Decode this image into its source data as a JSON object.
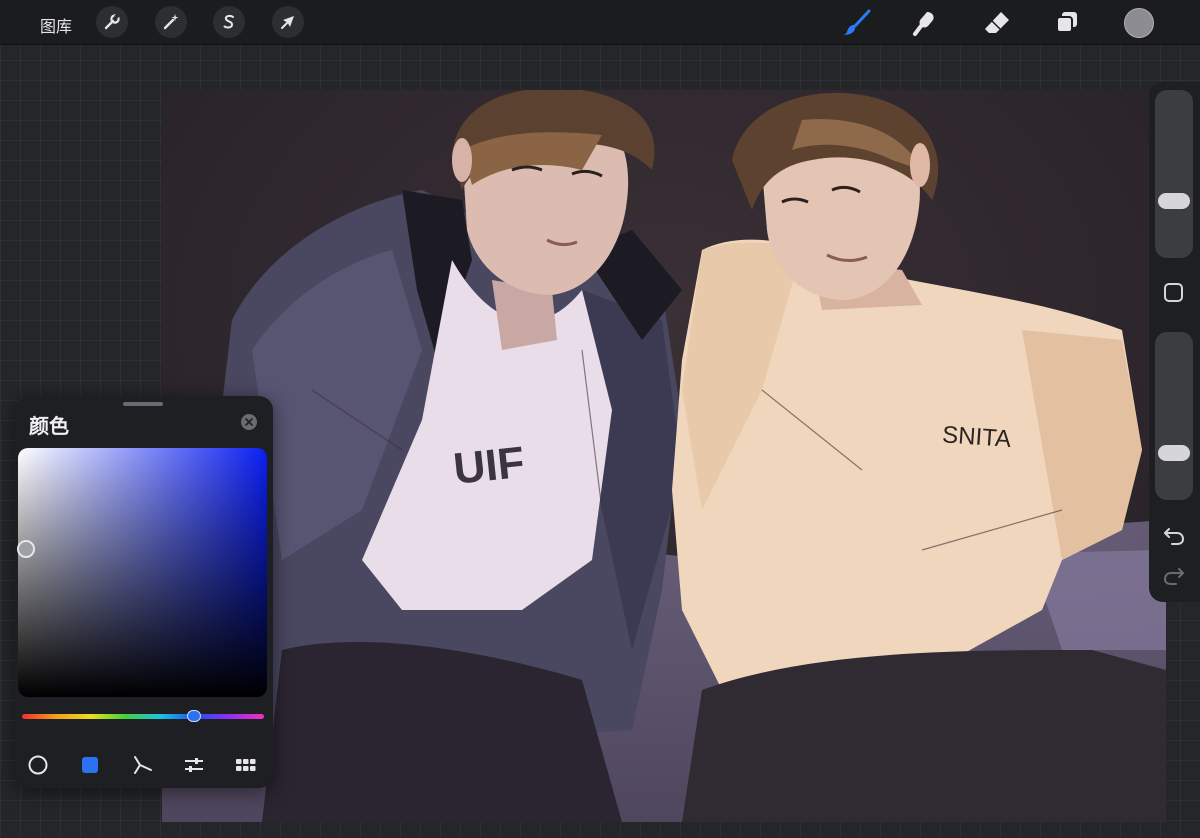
{
  "toolbar": {
    "gallery_label": "图库",
    "left_tools": [
      {
        "name": "actions",
        "icon": "wrench-icon"
      },
      {
        "name": "adjustments",
        "icon": "magic-wand-icon"
      },
      {
        "name": "selection",
        "icon": "selection-s-icon"
      },
      {
        "name": "transform",
        "icon": "arrow-cursor-icon"
      }
    ],
    "right_tools": [
      {
        "name": "brush",
        "icon": "brush-icon",
        "active": true
      },
      {
        "name": "smudge",
        "icon": "smudge-icon"
      },
      {
        "name": "eraser",
        "icon": "eraser-icon"
      },
      {
        "name": "layers",
        "icon": "layers-icon"
      }
    ],
    "current_color": "#8c8c92",
    "active_color": "#2a7bf6"
  },
  "sidebar": {
    "brush_size_level": 0.62,
    "opacity_level": 0.82,
    "modify_icon": "square-icon",
    "undo_icon": "undo-icon",
    "redo_icon": "redo-icon"
  },
  "artwork": {
    "shirt_text": "SNITA",
    "tshirt_partial_text": "UIF"
  },
  "color_panel": {
    "title": "颜色",
    "hue_color": "#0a1ff2",
    "hue_level": 0.69,
    "selected_swatch": "#2a72f2",
    "tabs": [
      {
        "name": "disc",
        "icon": "circle-outline-icon"
      },
      {
        "name": "classic",
        "icon": "filled-square-icon",
        "active": true
      },
      {
        "name": "harmony",
        "icon": "harmony-icon"
      },
      {
        "name": "value",
        "icon": "sliders-icon"
      },
      {
        "name": "palettes",
        "icon": "grid-icon"
      }
    ]
  }
}
